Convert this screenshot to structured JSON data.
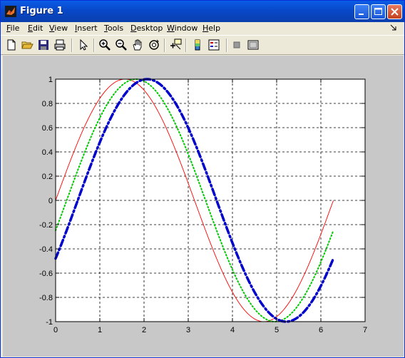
{
  "window": {
    "title": "Figure 1"
  },
  "menu": {
    "items": [
      {
        "label": "File",
        "u": "F",
        "rest": "ile"
      },
      {
        "label": "Edit",
        "u": "E",
        "rest": "dit"
      },
      {
        "label": "View",
        "u": "V",
        "rest": "iew"
      },
      {
        "label": "Insert",
        "u": "I",
        "rest": "nsert"
      },
      {
        "label": "Tools",
        "u": "T",
        "rest": "ools"
      },
      {
        "label": "Desktop",
        "u": "D",
        "rest": "esktop"
      },
      {
        "label": "Window",
        "u": "W",
        "rest": "indow"
      },
      {
        "label": "Help",
        "u": "H",
        "rest": "elp"
      }
    ],
    "overflow_icon": "menu-overflow-arrow"
  },
  "toolbar": {
    "icons": [
      "new-figure-icon",
      "open-file-icon",
      "save-icon",
      "print-icon",
      "edit-plot-arrow-icon",
      "zoom-in-icon",
      "zoom-out-icon",
      "pan-hand-icon",
      "rotate-3d-icon",
      "data-cursor-icon",
      "colorbar-icon",
      "legend-icon",
      "hide-plot-tools-icon",
      "show-plot-tools-icon"
    ]
  },
  "chart_data": {
    "type": "line",
    "title": "",
    "xlabel": "",
    "ylabel": "",
    "xlim": [
      0,
      7
    ],
    "ylim": [
      -1,
      1
    ],
    "xticks": [
      "0",
      "1",
      "2",
      "3",
      "4",
      "5",
      "6",
      "7"
    ],
    "yticks": [
      "1",
      "0.8",
      "0.6",
      "0.4",
      "0.2",
      "0",
      "-0.2",
      "-0.4",
      "-0.6",
      "-0.8",
      "-1"
    ],
    "grid": true,
    "x_range": [
      0,
      6.28
    ],
    "series": [
      {
        "function": "sin(x)",
        "color": "#ff0000",
        "style": "solid",
        "line_width": "thin"
      },
      {
        "function": "sin(x-0.25)",
        "color": "#00cc00",
        "style": "dotted",
        "line_width": "medium"
      },
      {
        "function": "sin(x-0.5)",
        "color": "#0000cc",
        "style": "dash-dot",
        "line_width": "thick"
      }
    ]
  }
}
